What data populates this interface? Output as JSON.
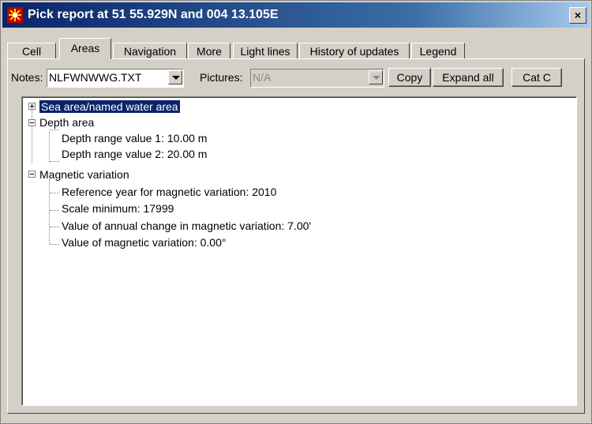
{
  "window": {
    "title": "Pick report at 51 55.929N and 004 13.105E",
    "close_label": "×"
  },
  "tabs": [
    {
      "label": "Cell",
      "active": false
    },
    {
      "label": "Areas",
      "active": true
    },
    {
      "label": "Navigation",
      "active": false
    },
    {
      "label": "More",
      "active": false
    },
    {
      "label": "Light lines",
      "active": false
    },
    {
      "label": "History of updates",
      "active": false
    },
    {
      "label": "Legend",
      "active": false
    }
  ],
  "toolbar": {
    "notes_label": "Notes:",
    "notes_value": "NLFWNWWG.TXT",
    "pictures_label": "Pictures:",
    "pictures_value": "N/A",
    "copy_label": "Copy",
    "expand_all_label": "Expand all",
    "cat_label": "Cat C"
  },
  "tree": {
    "nodes": [
      {
        "label": "Sea area/named water area",
        "expanded": false,
        "selected": true
      },
      {
        "label": "Depth area",
        "expanded": true,
        "children": [
          "Depth range value 1:  10.00 m",
          "Depth range value 2:  20.00 m"
        ]
      },
      {
        "label": "Magnetic variation",
        "expanded": true,
        "children": [
          "Reference year for magnetic variation:  2010",
          "Scale minimum:  17999",
          "Value of annual change in magnetic variation:  7.00'",
          "Value of magnetic variation:  0.00°"
        ]
      }
    ]
  },
  "colors": {
    "title_bar": "#0a246a",
    "selection": "#0a246a",
    "face": "#d4d0c8"
  }
}
